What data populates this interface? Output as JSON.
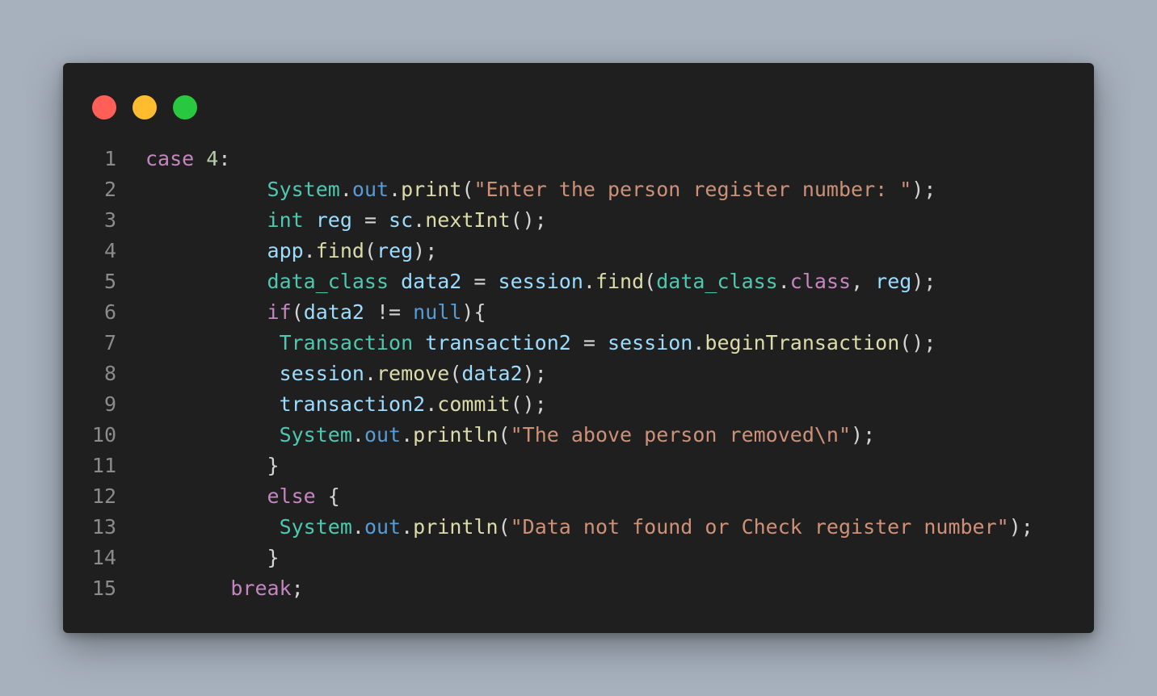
{
  "window": {
    "controls": [
      {
        "name": "close",
        "color": "#ff5f57"
      },
      {
        "name": "minimize",
        "color": "#febc2e"
      },
      {
        "name": "maximize",
        "color": "#28c840"
      }
    ]
  },
  "code": {
    "line_numbers": [
      "1",
      "2",
      "3",
      "4",
      "5",
      "6",
      "7",
      "8",
      "9",
      "10",
      "11",
      "12",
      "13",
      "14",
      "15"
    ],
    "lines": [
      [
        {
          "t": "case",
          "c": "kw"
        },
        {
          "t": " ",
          "c": "pn"
        },
        {
          "t": "4",
          "c": "nm"
        },
        {
          "t": ":",
          "c": "pn"
        }
      ],
      [
        {
          "t": "          ",
          "c": "pn"
        },
        {
          "t": "System",
          "c": "ty"
        },
        {
          "t": ".",
          "c": "pn"
        },
        {
          "t": "out",
          "c": "bl"
        },
        {
          "t": ".",
          "c": "pn"
        },
        {
          "t": "print",
          "c": "fn"
        },
        {
          "t": "(",
          "c": "pn"
        },
        {
          "t": "\"Enter the person register number: \"",
          "c": "st"
        },
        {
          "t": ");",
          "c": "pn"
        }
      ],
      [
        {
          "t": "          ",
          "c": "pn"
        },
        {
          "t": "int",
          "c": "ty"
        },
        {
          "t": " ",
          "c": "pn"
        },
        {
          "t": "reg",
          "c": "vr"
        },
        {
          "t": " = ",
          "c": "pn"
        },
        {
          "t": "sc",
          "c": "vr"
        },
        {
          "t": ".",
          "c": "pn"
        },
        {
          "t": "nextInt",
          "c": "fn"
        },
        {
          "t": "();",
          "c": "pn"
        }
      ],
      [
        {
          "t": "          ",
          "c": "pn"
        },
        {
          "t": "app",
          "c": "vr"
        },
        {
          "t": ".",
          "c": "pn"
        },
        {
          "t": "find",
          "c": "fn"
        },
        {
          "t": "(",
          "c": "pn"
        },
        {
          "t": "reg",
          "c": "vr"
        },
        {
          "t": ");",
          "c": "pn"
        }
      ],
      [
        {
          "t": "          ",
          "c": "pn"
        },
        {
          "t": "data_class",
          "c": "ty"
        },
        {
          "t": " ",
          "c": "pn"
        },
        {
          "t": "data2",
          "c": "vr"
        },
        {
          "t": " = ",
          "c": "pn"
        },
        {
          "t": "session",
          "c": "vr"
        },
        {
          "t": ".",
          "c": "pn"
        },
        {
          "t": "find",
          "c": "fn"
        },
        {
          "t": "(",
          "c": "pn"
        },
        {
          "t": "data_class",
          "c": "ty"
        },
        {
          "t": ".",
          "c": "pn"
        },
        {
          "t": "class",
          "c": "kw"
        },
        {
          "t": ", ",
          "c": "pn"
        },
        {
          "t": "reg",
          "c": "vr"
        },
        {
          "t": ");",
          "c": "pn"
        }
      ],
      [
        {
          "t": "          ",
          "c": "pn"
        },
        {
          "t": "if",
          "c": "kw"
        },
        {
          "t": "(",
          "c": "pn"
        },
        {
          "t": "data2",
          "c": "vr"
        },
        {
          "t": " != ",
          "c": "pn"
        },
        {
          "t": "null",
          "c": "bl"
        },
        {
          "t": "){",
          "c": "pn"
        }
      ],
      [
        {
          "t": "           ",
          "c": "pn"
        },
        {
          "t": "Transaction",
          "c": "ty"
        },
        {
          "t": " ",
          "c": "pn"
        },
        {
          "t": "transaction2",
          "c": "vr"
        },
        {
          "t": " = ",
          "c": "pn"
        },
        {
          "t": "session",
          "c": "vr"
        },
        {
          "t": ".",
          "c": "pn"
        },
        {
          "t": "beginTransaction",
          "c": "fn"
        },
        {
          "t": "();",
          "c": "pn"
        }
      ],
      [
        {
          "t": "           ",
          "c": "pn"
        },
        {
          "t": "session",
          "c": "vr"
        },
        {
          "t": ".",
          "c": "pn"
        },
        {
          "t": "remove",
          "c": "fn"
        },
        {
          "t": "(",
          "c": "pn"
        },
        {
          "t": "data2",
          "c": "vr"
        },
        {
          "t": ");",
          "c": "pn"
        }
      ],
      [
        {
          "t": "           ",
          "c": "pn"
        },
        {
          "t": "transaction2",
          "c": "vr"
        },
        {
          "t": ".",
          "c": "pn"
        },
        {
          "t": "commit",
          "c": "fn"
        },
        {
          "t": "();",
          "c": "pn"
        }
      ],
      [
        {
          "t": "           ",
          "c": "pn"
        },
        {
          "t": "System",
          "c": "ty"
        },
        {
          "t": ".",
          "c": "pn"
        },
        {
          "t": "out",
          "c": "bl"
        },
        {
          "t": ".",
          "c": "pn"
        },
        {
          "t": "println",
          "c": "fn"
        },
        {
          "t": "(",
          "c": "pn"
        },
        {
          "t": "\"The above person removed\\n\"",
          "c": "st"
        },
        {
          "t": ");",
          "c": "pn"
        }
      ],
      [
        {
          "t": "          ",
          "c": "pn"
        },
        {
          "t": "}",
          "c": "pn"
        }
      ],
      [
        {
          "t": "          ",
          "c": "pn"
        },
        {
          "t": "else",
          "c": "kw"
        },
        {
          "t": " {",
          "c": "pn"
        }
      ],
      [
        {
          "t": "           ",
          "c": "pn"
        },
        {
          "t": "System",
          "c": "ty"
        },
        {
          "t": ".",
          "c": "pn"
        },
        {
          "t": "out",
          "c": "bl"
        },
        {
          "t": ".",
          "c": "pn"
        },
        {
          "t": "println",
          "c": "fn"
        },
        {
          "t": "(",
          "c": "pn"
        },
        {
          "t": "\"Data not found or Check register number\"",
          "c": "st"
        },
        {
          "t": ");",
          "c": "pn"
        }
      ],
      [
        {
          "t": "          ",
          "c": "pn"
        },
        {
          "t": "}",
          "c": "pn"
        }
      ],
      [
        {
          "t": "       ",
          "c": "pn"
        },
        {
          "t": "break",
          "c": "kw"
        },
        {
          "t": ";",
          "c": "pn"
        }
      ]
    ]
  }
}
